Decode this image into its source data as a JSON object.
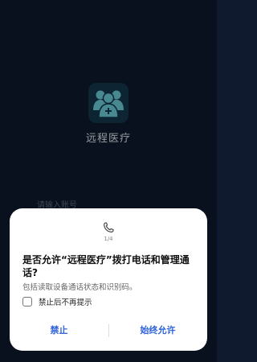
{
  "app": {
    "name": "远程医疗"
  },
  "login": {
    "account_placeholder": "请输入账号"
  },
  "dialog": {
    "page_indicator": "1/4",
    "title": "是否允许“远程医疗”拨打电话和管理通话?",
    "description": "包括读取设备通话状态和识别码。",
    "checkbox_label": "禁止后不再提示",
    "checkbox_checked": false,
    "deny_label": "禁止",
    "allow_label": "始终允许"
  },
  "colors": {
    "background": "#0f1a2e",
    "accent": "#2e62d9",
    "logo_bg": "#14384e",
    "logo_figure": "#6fd2dd"
  },
  "icons": {
    "app_logo": "medical-doctors-icon",
    "permission": "phone-icon"
  }
}
